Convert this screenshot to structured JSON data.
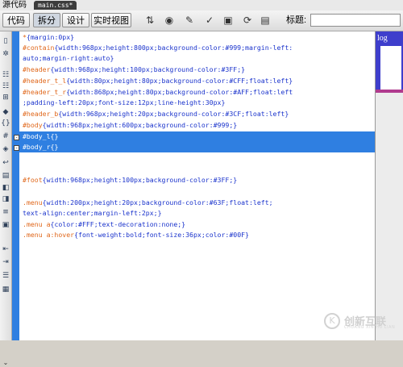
{
  "window": {
    "title": "源代码",
    "file_tab": "main.css*"
  },
  "toolbar": {
    "code_label": "代码",
    "split_label": "拆分",
    "design_label": "设计",
    "live_view_label": "实时视图",
    "title_label": "标题:",
    "title_value": ""
  },
  "editor": {
    "lines": [
      {
        "sel": "*",
        "rest": "{margin:0px}"
      },
      {
        "sel": "#contain",
        "rest": "{width:968px;height:800px;background-color:#999;margin-left:"
      },
      {
        "sel": "",
        "rest": "auto;margin-right:auto}"
      },
      {
        "sel": "#header",
        "rest": "{width:968px;height:100px;background-color:#3FF;}"
      },
      {
        "sel": "#header_t_l",
        "rest": "{width:80px;height:80px;background-color:#CFF;float:left}"
      },
      {
        "sel": "#header_t_r",
        "rest": "{width:868px;height:80px;background-color:#AFF;float:left"
      },
      {
        "sel": "",
        "rest": ";padding-left:20px;font-size:12px;line-height:30px}"
      },
      {
        "sel": "#header_b",
        "rest": "{width:968px;height:20px;background-color:#3CF;float:left}"
      },
      {
        "sel": "#body",
        "rest": "{width:968px;height:600px;background-color:#999;}"
      },
      {
        "sel": "#body_l",
        "rest": "{}"
      },
      {
        "sel": "#body_r",
        "rest": "{}"
      },
      {
        "sel": "#foot",
        "rest": "{width:968px;height:100px;background-color:#3FF;}"
      },
      {
        "sel": ".menu",
        "rest": "{width:200px;height:20px;background-color:#63F;float:left;"
      },
      {
        "sel": "",
        "rest": "text-align:center;margin-left:2px;}"
      },
      {
        "sel": ".menu a",
        "rest": "{color:#FFF;text-decoration:none;}"
      },
      {
        "sel": ".menu a:hover",
        "rest": "{font-weight:bold;font-size:36px;color:#00F}"
      }
    ]
  },
  "right_panel": {
    "snippet": "log"
  },
  "watermark": {
    "logo": "K",
    "text": "创新互联",
    "sub": "CHUANG XIN HU LIAN"
  },
  "colors": {
    "selection": "#2f7fe1",
    "selector": "#e0681c",
    "property": "#1a33cc"
  },
  "icons": {
    "toolbar": [
      "file-management-icon",
      "preview-browser-icon",
      "check-page-icon",
      "validate-icon",
      "visual-aids-icon",
      "refresh-icon"
    ],
    "left": [
      "open-documents-icon",
      "show-code-navigator-icon",
      "collapse-full-tag-icon",
      "collapse-selection-icon",
      "expand-all-icon",
      "select-parent-tag-icon",
      "balance-braces-icon",
      "line-numbers-icon",
      "highlight-invalid-code-icon",
      "word-wrap-icon",
      "syntax-error-alerts-icon",
      "apply-comment-icon",
      "remove-comment-icon",
      "wrap-tag-icon",
      "recent-snippets-icon",
      "move-css-icon",
      "indent-code-icon",
      "outdent-code-icon",
      "format-source-icon"
    ]
  }
}
